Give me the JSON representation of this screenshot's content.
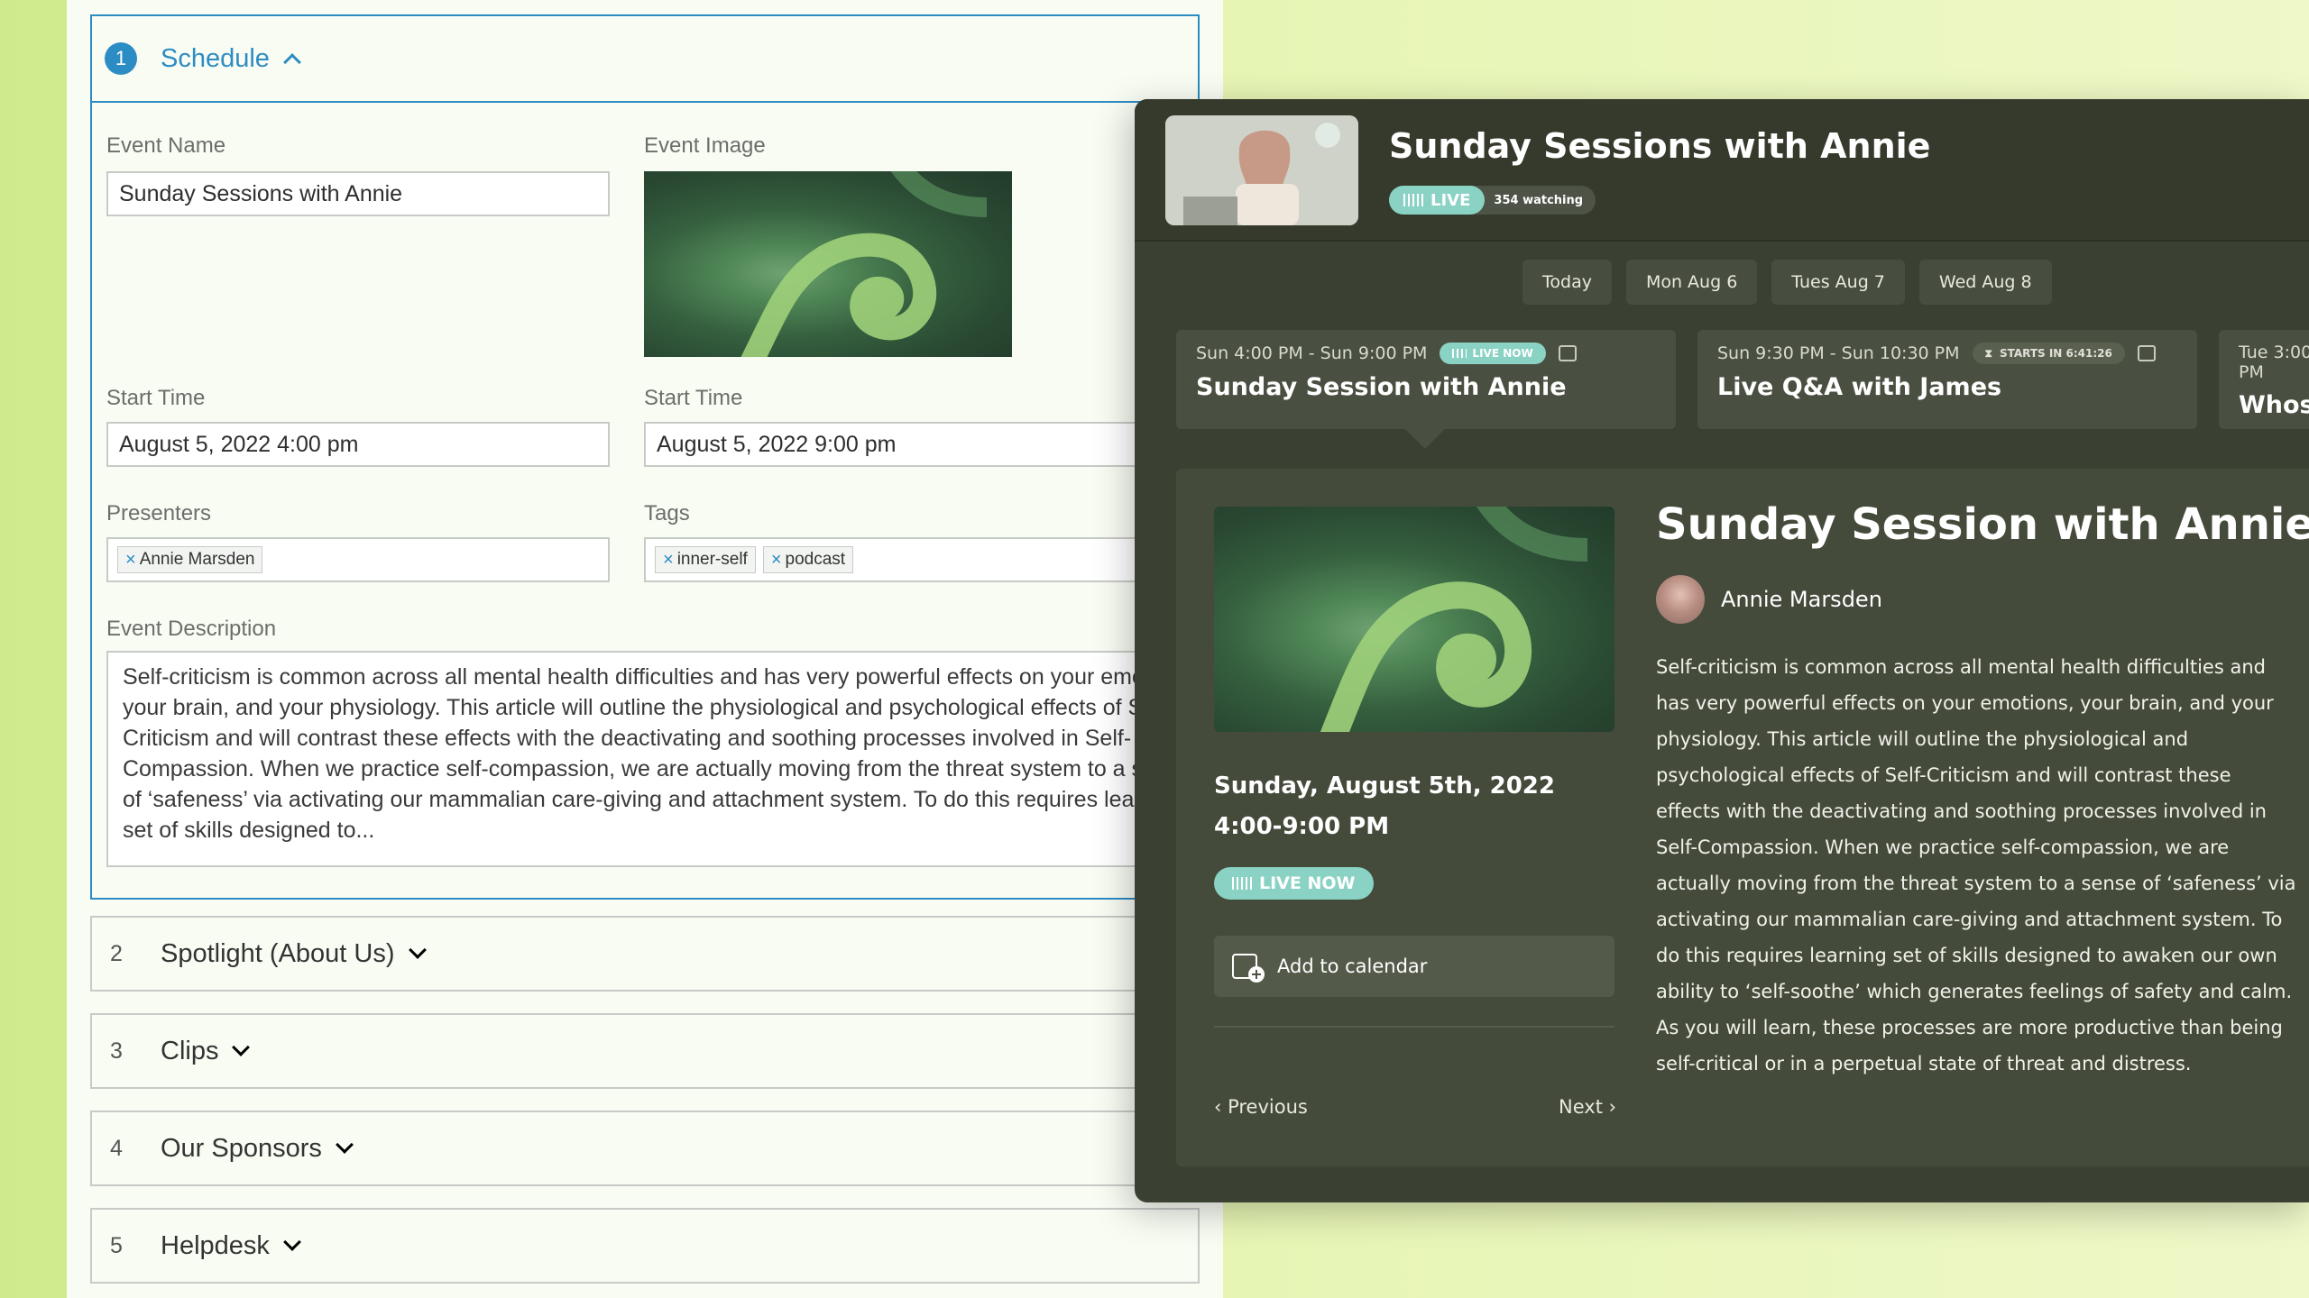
{
  "editor": {
    "section1": {
      "num": "1",
      "title": "Schedule"
    },
    "labels": {
      "event_name": "Event Name",
      "event_image": "Event Image",
      "start_time_1": "Start Time",
      "start_time_2": "Start Time",
      "presenters": "Presenters",
      "tags": "Tags",
      "description": "Event Description"
    },
    "values": {
      "event_name": "Sunday Sessions with Annie",
      "start_time_1": "August 5, 2022 4:00 pm",
      "start_time_2": "August 5, 2022 9:00 pm",
      "presenters": [
        "Annie Marsden"
      ],
      "tags": [
        "inner-self",
        "podcast"
      ],
      "description": "Self-criticism is common across all mental health difficulties and has very powerful effects on your emotions, your brain, and your physiology. This article will outline the physiological and psychological effects of Self-Criticism and will contrast these effects with the deactivating and soothing processes involved in Self-Compassion. When we practice self-compassion, we are actually moving from the threat system to a sense of ‘safeness’ via activating our mammalian care-giving and attachment system. To do this requires learning set of skills designed to..."
    },
    "sections": [
      {
        "num": "2",
        "title": "Spotlight (About Us)"
      },
      {
        "num": "3",
        "title": "Clips"
      },
      {
        "num": "4",
        "title": "Our Sponsors"
      },
      {
        "num": "5",
        "title": "Helpdesk"
      }
    ]
  },
  "player": {
    "title": "Sunday Sessions with Annie",
    "live_label": "LIVE",
    "watching": "354 watching",
    "day_tabs": [
      "Today",
      "Mon Aug 6",
      "Tues Aug 7",
      "Wed Aug 8"
    ],
    "sessions": [
      {
        "time": "Sun 4:00 PM - Sun 9:00 PM",
        "badge": "LIVE NOW",
        "title": "Sunday Session with Annie"
      },
      {
        "time": "Sun 9:30 PM - Sun 10:30 PM",
        "badge": "STARTS IN 6:41:26",
        "title": "Live Q&A with James"
      },
      {
        "time": "Tue 3:00 PM",
        "title": "Whose go"
      }
    ],
    "detail": {
      "title": "Sunday Session with Annie",
      "presenter": "Annie Marsden",
      "date": "Sunday, August 5th, 2022",
      "time": "4:00-9:00 PM",
      "live_now": "LIVE NOW",
      "add_to_calendar": "Add to calendar",
      "previous": "Previous",
      "next": "Next",
      "description": "Self-criticism is common across all mental health difficulties and has very powerful effects on your emotions, your brain, and your physiology. This article will outline the physiological and psychological effects of Self-Criticism and will contrast these effects with the deactivating and soothing processes involved in Self-Compassion. When we practice self-compassion, we are actually moving from the threat system to a sense of ‘safeness’ via activating our mammalian care-giving and attachment system. To do this requires learning set of skills designed to awaken our own ability to ‘self-soothe’ which generates feelings of safety and calm. As you will learn, these processes are more productive than being self-critical or in a perpetual state of threat and distress."
    }
  },
  "colors": {
    "accent_blue": "#2c8cc4",
    "live_teal": "#8ad3c4",
    "dark_panel": "#3b4132"
  }
}
